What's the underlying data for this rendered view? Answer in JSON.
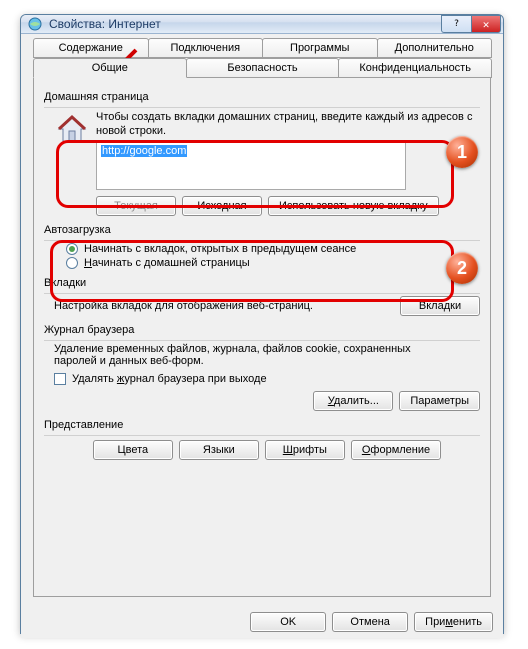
{
  "window": {
    "title": "Свойства: Интернет"
  },
  "tabs_row1": [
    "Содержание",
    "Подключения",
    "Программы",
    "Дополнительно"
  ],
  "tabs_row2": [
    "Общие",
    "Безопасность",
    "Конфиденциальность"
  ],
  "active_tab": "Общие",
  "sections": {
    "homepage": {
      "label": "Домашняя страница",
      "hint": "Чтобы создать вкладки домашних страниц, введите каждый из адресов с новой строки.",
      "url_value": "http://google.com",
      "buttons": {
        "current": "Текущая",
        "default": "Исходная",
        "new_tab": "Использовать новую вкладку"
      }
    },
    "startup": {
      "label": "Автозагрузка",
      "opt1": "Начинать с вкладок, открытых в предыдущем сеансе",
      "opt2": "Начинать с домашней страницы",
      "selected": "opt1"
    },
    "tabs": {
      "label": "Вкладки",
      "hint": "Настройка вкладок для отображения веб-страниц.",
      "button": "Вкладки"
    },
    "history": {
      "label": "Журнал браузера",
      "hint": "Удаление временных файлов, журнала, файлов cookie, сохраненных паролей и данных веб-форм.",
      "checkbox": "Удалять журнал браузера при выходе",
      "buttons": {
        "delete": "Удалить...",
        "params": "Параметры"
      }
    },
    "appearance": {
      "label": "Представление",
      "buttons": {
        "colors": "Цвета",
        "langs": "Языки",
        "fonts": "Шрифты",
        "style": "Оформление"
      }
    }
  },
  "footer": {
    "ok": "OK",
    "cancel": "Отмена",
    "apply": "Применить"
  },
  "annotations": {
    "badge1": "1",
    "badge2": "2"
  }
}
